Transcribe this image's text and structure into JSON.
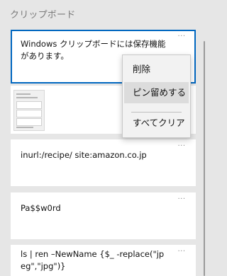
{
  "panel": {
    "title": "クリップボード"
  },
  "items": [
    {
      "type": "text",
      "text": "Windows クリップボードには保存機能があります。",
      "more": "···"
    },
    {
      "type": "image",
      "more": "···"
    },
    {
      "type": "text",
      "text": "inurl:/recipe/ site:amazon.co.jp",
      "more": "···"
    },
    {
      "type": "text",
      "text": "Pa$$w0rd",
      "more": "···"
    },
    {
      "type": "text",
      "text": "ls | ren –NewName {$_ -replace(\"jpeg\",\"jpg\")}",
      "more": "···"
    }
  ],
  "context_menu": {
    "items": [
      {
        "label": "削除"
      },
      {
        "label": "ピン留めする"
      },
      {
        "label": "すべてクリア"
      }
    ]
  }
}
